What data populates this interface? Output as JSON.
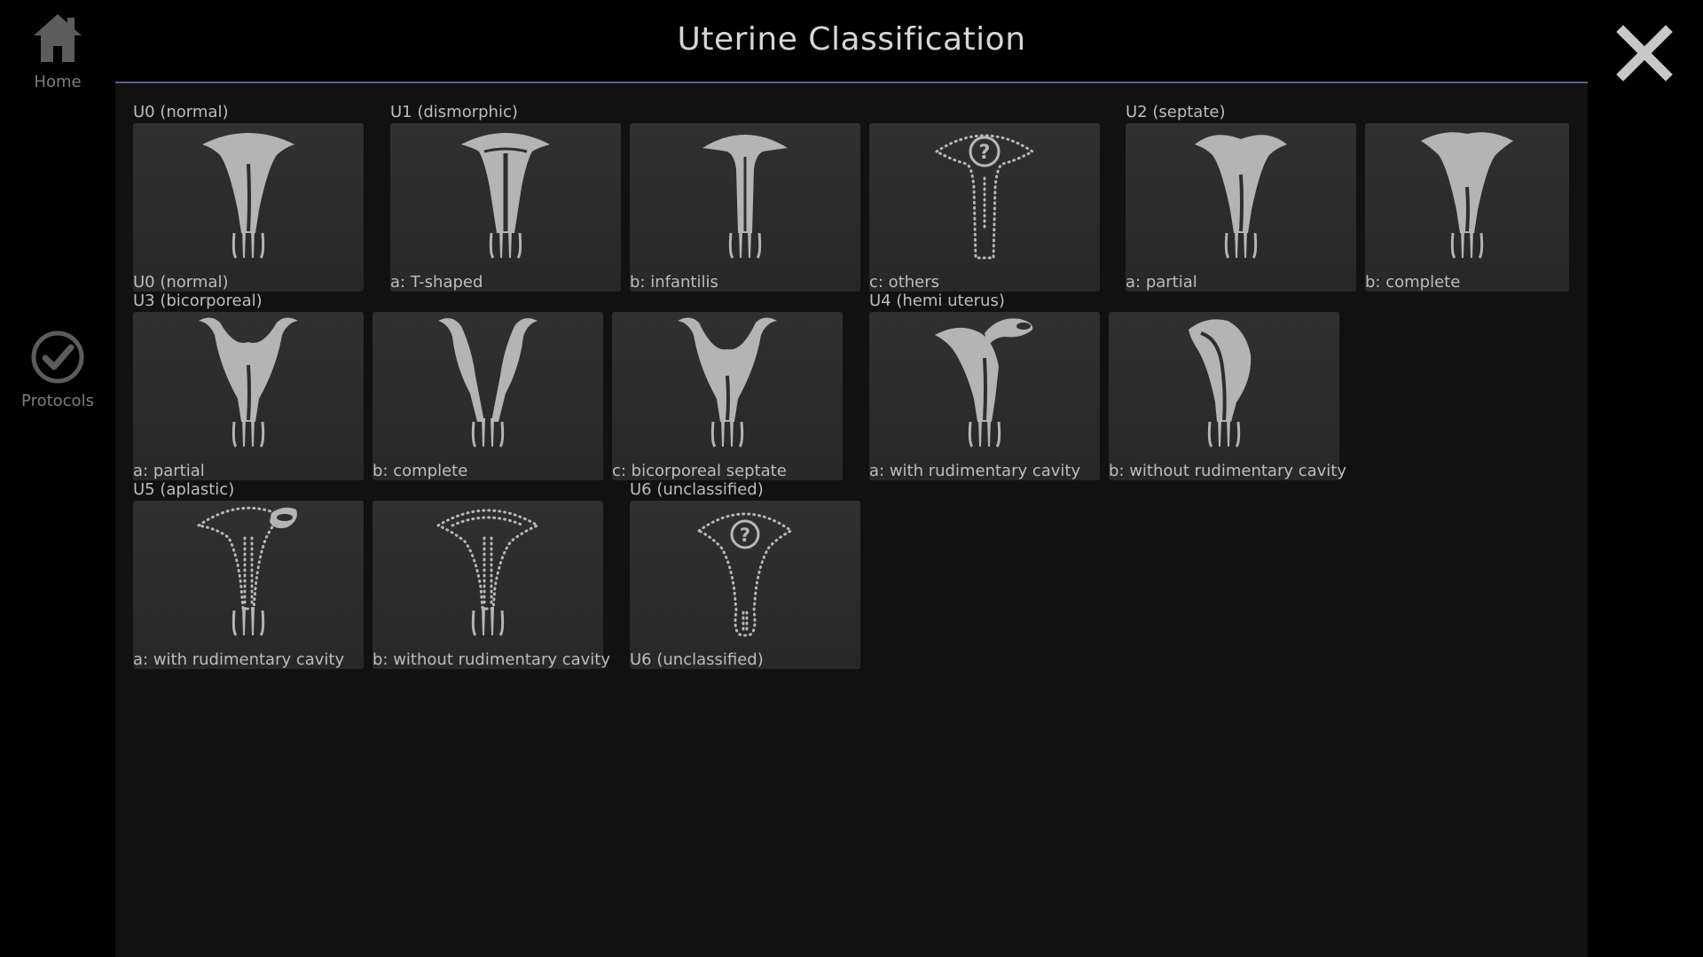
{
  "title": "Uterine Classification",
  "sidebar": {
    "home_label": "Home",
    "protocols_label": "Protocols"
  },
  "groups": {
    "u0": "U0 (normal)",
    "u1": "U1 (dismorphic)",
    "u2": "U2 (septate)",
    "u3": "U3 (bicorporeal)",
    "u4": "U4 (hemi uterus)",
    "u5": "U5 (aplastic)",
    "u6": "U6 (unclassified)"
  },
  "tiles": {
    "u0_normal": "U0 (normal)",
    "u1_a": "a: T-shaped",
    "u1_b": "b: infantilis",
    "u1_c": "c: others",
    "u2_a": "a: partial",
    "u2_b": "b: complete",
    "u3_a": "a: partial",
    "u3_b": "b: complete",
    "u3_c": "c: bicorporeal septate",
    "u4_a": "a: with rudimentary cavity",
    "u4_b": "b: without rudimentary cavity",
    "u5_a": "a: with rudimentary cavity",
    "u5_b": "b: without rudimentary cavity",
    "u6": "U6 (unclassified)"
  },
  "icons": {
    "home": "home-icon",
    "protocols": "check-circle-icon",
    "close": "close-icon"
  },
  "colors": {
    "background": "#000000",
    "panel": "#111111",
    "tile": "#2d2d2d",
    "accent_line": "#5a5f92",
    "figure": "#b4b4b4"
  }
}
